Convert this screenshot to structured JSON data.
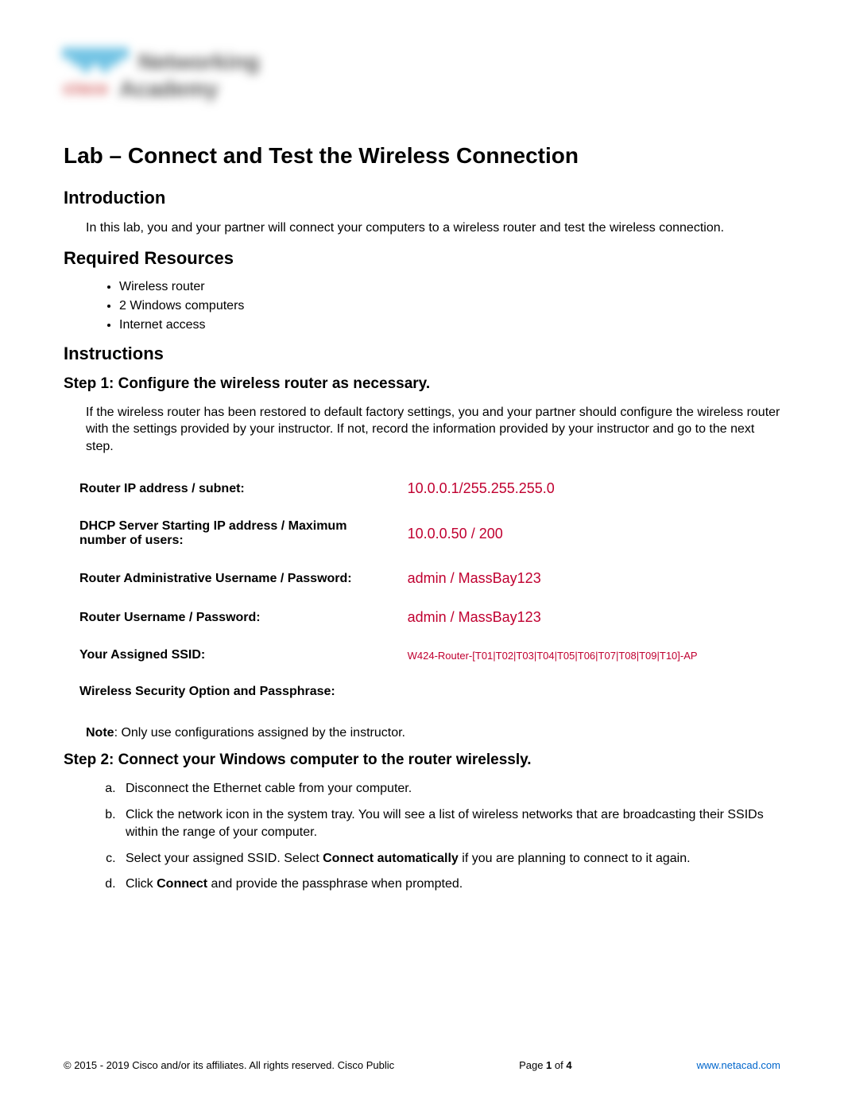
{
  "logo": {
    "top_word": "Networking",
    "bottom_word": "Academy",
    "brand": "cisco"
  },
  "title": "Lab – Connect and Test the Wireless Connection",
  "sections": {
    "intro": {
      "heading": "Introduction",
      "text": "In this lab, you and your partner will connect your computers to a wireless router and test the wireless connection."
    },
    "resources": {
      "heading": "Required Resources",
      "items": [
        "Wireless router",
        "2 Windows computers",
        "Internet access"
      ]
    },
    "instructions": {
      "heading": "Instructions",
      "step1": {
        "heading": "Step 1: Configure the wireless router as necessary.",
        "text": "If the wireless router has been restored to default factory settings, you and your partner should configure the wireless router with the settings provided by your instructor. If not, record the information provided by your instructor and go to the next step.",
        "rows": [
          {
            "label": "Router IP address / subnet:",
            "value": "10.0.0.1/255.255.255.0",
            "small": false
          },
          {
            "label": "DHCP Server Starting IP address / Maximum number of users:",
            "value": "10.0.0.50 / 200",
            "small": false
          },
          {
            "label": "Router Administrative Username / Password:",
            "value": "admin  /  MassBay123",
            "small": false
          },
          {
            "label": "Router Username / Password:",
            "value": "admin  /  MassBay123",
            "small": false
          },
          {
            "label": "Your Assigned SSID:",
            "value": "W424-Router-[T01|T02|T03|T04|T05|T06|T07|T08|T09|T10]-AP",
            "small": true
          },
          {
            "label": "Wireless Security Option and Passphrase:",
            "value": "",
            "small": false
          }
        ],
        "note_prefix": "Note",
        "note_text": ": Only use configurations assigned by the instructor."
      },
      "step2": {
        "heading": "Step 2: Connect your Windows computer to the router wirelessly.",
        "items": [
          {
            "text_before": "Disconnect the Ethernet cable from your computer.",
            "bold": "",
            "text_after": ""
          },
          {
            "text_before": "Click the network icon in the system tray. You will see a list of wireless networks that are broadcasting their SSIDs within the range of your computer.",
            "bold": "",
            "text_after": ""
          },
          {
            "text_before": "Select your assigned SSID. Select ",
            "bold": "Connect automatically",
            "text_after": " if you are planning to connect to it again."
          },
          {
            "text_before": "Click ",
            "bold": "Connect",
            "text_after": " and provide the passphrase when prompted."
          }
        ]
      }
    }
  },
  "footer": {
    "copyright": "© 2015 - 2019 Cisco and/or its affiliates. All rights reserved. Cisco Public",
    "page_prefix": "Page ",
    "page_current": "1",
    "page_sep": " of ",
    "page_total": "4",
    "link": "www.netacad.com"
  }
}
